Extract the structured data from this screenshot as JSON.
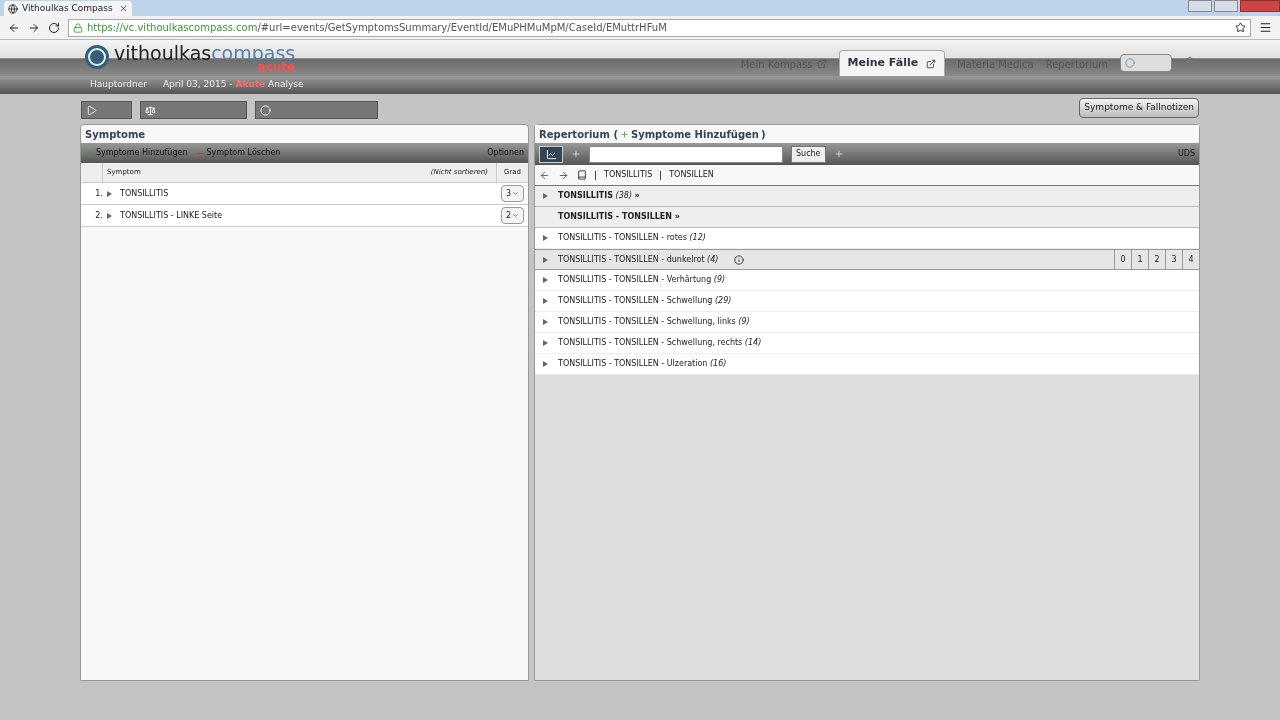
{
  "browser": {
    "tab_title": "Vithoulkas Compass",
    "url_host": "https://vc.vithoulkascompass.com",
    "url_path": "/#url=events/GetSymptomsSummary/EventId/EMuPHMuMpM/CaseId/EMuttrHFuM"
  },
  "app": {
    "logo_main": "vithoulkas",
    "logo_accent": "compass",
    "logo_sub": "acute",
    "nav": [
      {
        "label": "Mein Kompass",
        "selected": false,
        "external": true
      },
      {
        "label": "Meine Fälle",
        "selected": true,
        "external": true
      },
      {
        "label": "Materia Medica",
        "selected": false,
        "external": false
      },
      {
        "label": "Repertorium",
        "selected": false,
        "external": false
      }
    ],
    "breadcrumb": {
      "root": "Hauptordner",
      "date": "April 03, 2015 - ",
      "accent": "Akute",
      "rest": " Analyse"
    }
  },
  "notes_button": "Symptome & Fallnotizen",
  "symptoms": {
    "title": "Symptome",
    "add": "Symptome Hinzufügen",
    "delete": "Symptom Löschen",
    "options": "Optionen",
    "col_symptom": "Symptom",
    "col_sort": "(Nicht sortieren)",
    "col_grade": "Grad",
    "rows": [
      {
        "number": "1.",
        "name": "TONSILLITIS",
        "grade": "3"
      },
      {
        "number": "2.",
        "name": "TONSILLITIS - LINKE Seite",
        "grade": "2"
      }
    ]
  },
  "repertory": {
    "title": "Repertorium (",
    "title_link": "Symptome Hinzufügen",
    "title_end": ")",
    "search_button": "Suche",
    "uds": "UDS",
    "path": [
      "TONSILLITIS",
      "TONSILLEN"
    ],
    "grades": [
      "0",
      "1",
      "2",
      "3",
      "4"
    ],
    "rubrics": [
      {
        "kind": "header",
        "text": "**TONSILLITIS** *(38)* **»**",
        "arrow": true,
        "highlighted": false
      },
      {
        "kind": "header",
        "text": "**TONSILLITIS - TONSILLEN »**",
        "arrow": false,
        "highlighted": false
      },
      {
        "kind": "item",
        "text": "TONSILLITIS - TONSILLEN - rotes *(12)*",
        "arrow": true,
        "highlighted": false
      },
      {
        "kind": "item",
        "text": "TONSILLITIS - TONSILLEN - dunkelrot *(4)*",
        "arrow": true,
        "highlighted": true
      },
      {
        "kind": "item",
        "text": "TONSILLITIS - TONSILLEN - Verhärtung *(9)*",
        "arrow": true,
        "highlighted": false
      },
      {
        "kind": "item",
        "text": "TONSILLITIS - TONSILLEN - Schwellung *(29)*",
        "arrow": true,
        "highlighted": false
      },
      {
        "kind": "item",
        "text": "TONSILLITIS - TONSILLEN - Schwellung, links *(9)*",
        "arrow": true,
        "highlighted": false
      },
      {
        "kind": "item",
        "text": "TONSILLITIS - TONSILLEN - Schwellung, rechts *(14)*",
        "arrow": true,
        "highlighted": false
      },
      {
        "kind": "item",
        "text": "TONSILLITIS - TONSILLEN - Ulzeration *(16)*",
        "arrow": true,
        "highlighted": false
      }
    ]
  }
}
